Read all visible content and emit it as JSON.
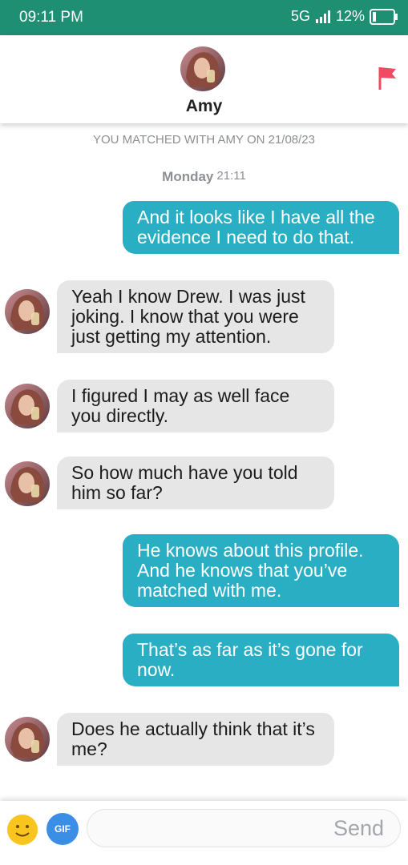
{
  "status": {
    "time": "09:11 PM",
    "network": "5G",
    "battery": "12%"
  },
  "header": {
    "name": "Amy",
    "flag_icon": "flag-icon",
    "flag_color": "#f04b62"
  },
  "chat": {
    "match_note": "YOU MATCHED WITH AMY ON 21/08/23",
    "day_label": "Monday",
    "day_time": "21:11",
    "messages": [
      {
        "from": "me",
        "text": "And it looks like I have all the evidence I need to do that."
      },
      {
        "from": "amy",
        "text": "Yeah I know Drew. I was just joking. I know that you were just getting my attention."
      },
      {
        "from": "amy",
        "text": "I figured I may as well face you directly."
      },
      {
        "from": "amy",
        "text": "So how much have you told him so far?"
      },
      {
        "from": "me",
        "text": "He knows about this profile. And he knows that you’ve matched with me."
      },
      {
        "from": "me",
        "text": "That’s as far as it’s gone for now."
      },
      {
        "from": "amy",
        "text": "Does he actually think that it’s me?"
      }
    ]
  },
  "composer": {
    "gif_label": "GIF",
    "input_value": "",
    "send_label": "Send"
  },
  "colors": {
    "statusbar": "#1f8f74",
    "outgoing_bubble": "#2aaec3",
    "incoming_bubble": "#e6e6e6"
  }
}
